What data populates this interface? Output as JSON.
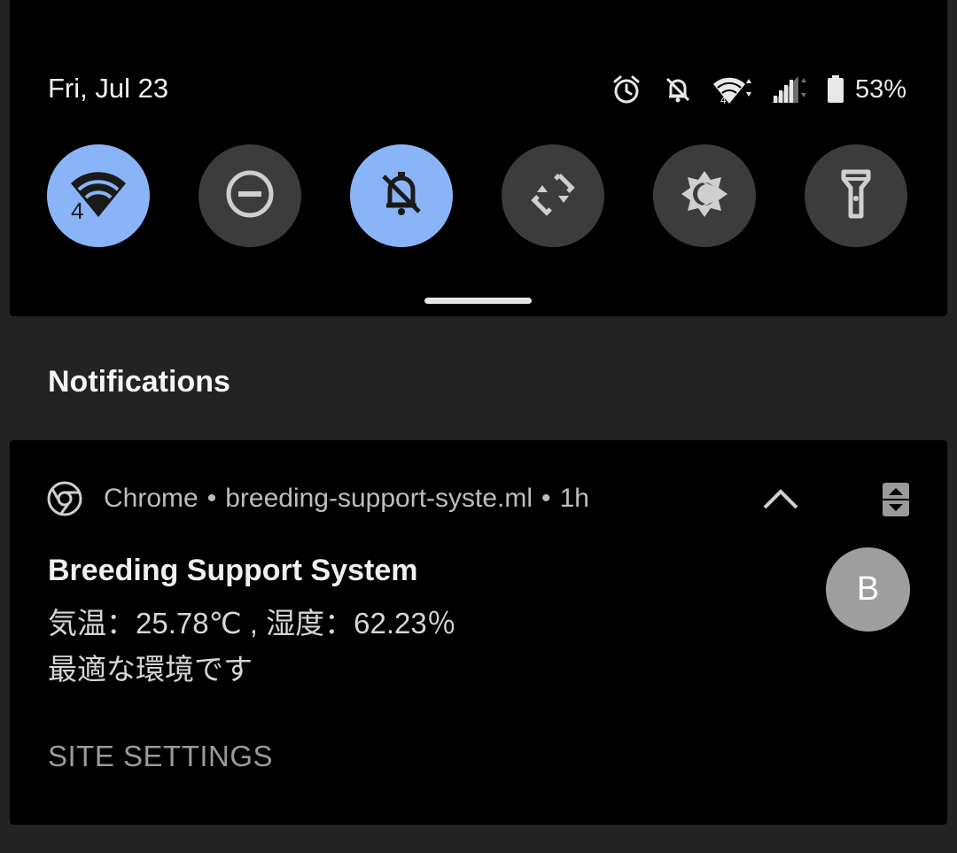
{
  "status_bar": {
    "date": "Fri, Jul 23",
    "wifi_badge": "4",
    "battery_percent": "53%",
    "icons": [
      "alarm-icon",
      "bell-off-icon",
      "wifi-icon",
      "cellular-signal-icon",
      "battery-icon"
    ]
  },
  "quick_settings": {
    "tiles": [
      {
        "name": "wifi",
        "icon": "wifi-icon",
        "active": true,
        "badge": "4"
      },
      {
        "name": "do-not-disturb",
        "icon": "do-not-disturb-icon",
        "active": false
      },
      {
        "name": "silent",
        "icon": "bell-off-icon",
        "active": true
      },
      {
        "name": "auto-rotate",
        "icon": "auto-rotate-icon",
        "active": false
      },
      {
        "name": "dark-theme",
        "icon": "dark-theme-icon",
        "active": false
      },
      {
        "name": "flashlight",
        "icon": "flashlight-icon",
        "active": false
      }
    ],
    "accent_color": "#8ab4f8"
  },
  "notifications": {
    "section_title": "Notifications",
    "items": [
      {
        "app": "Chrome",
        "separator": "•",
        "site": "breeding-support-syste.ml",
        "time": "1h",
        "title": "Breeding Support System",
        "line1": "気温：25.78℃ , 湿度：62.23％",
        "line2": "最適な環境です",
        "avatar_letter": "B",
        "action": "SITE SETTINGS"
      }
    ]
  }
}
